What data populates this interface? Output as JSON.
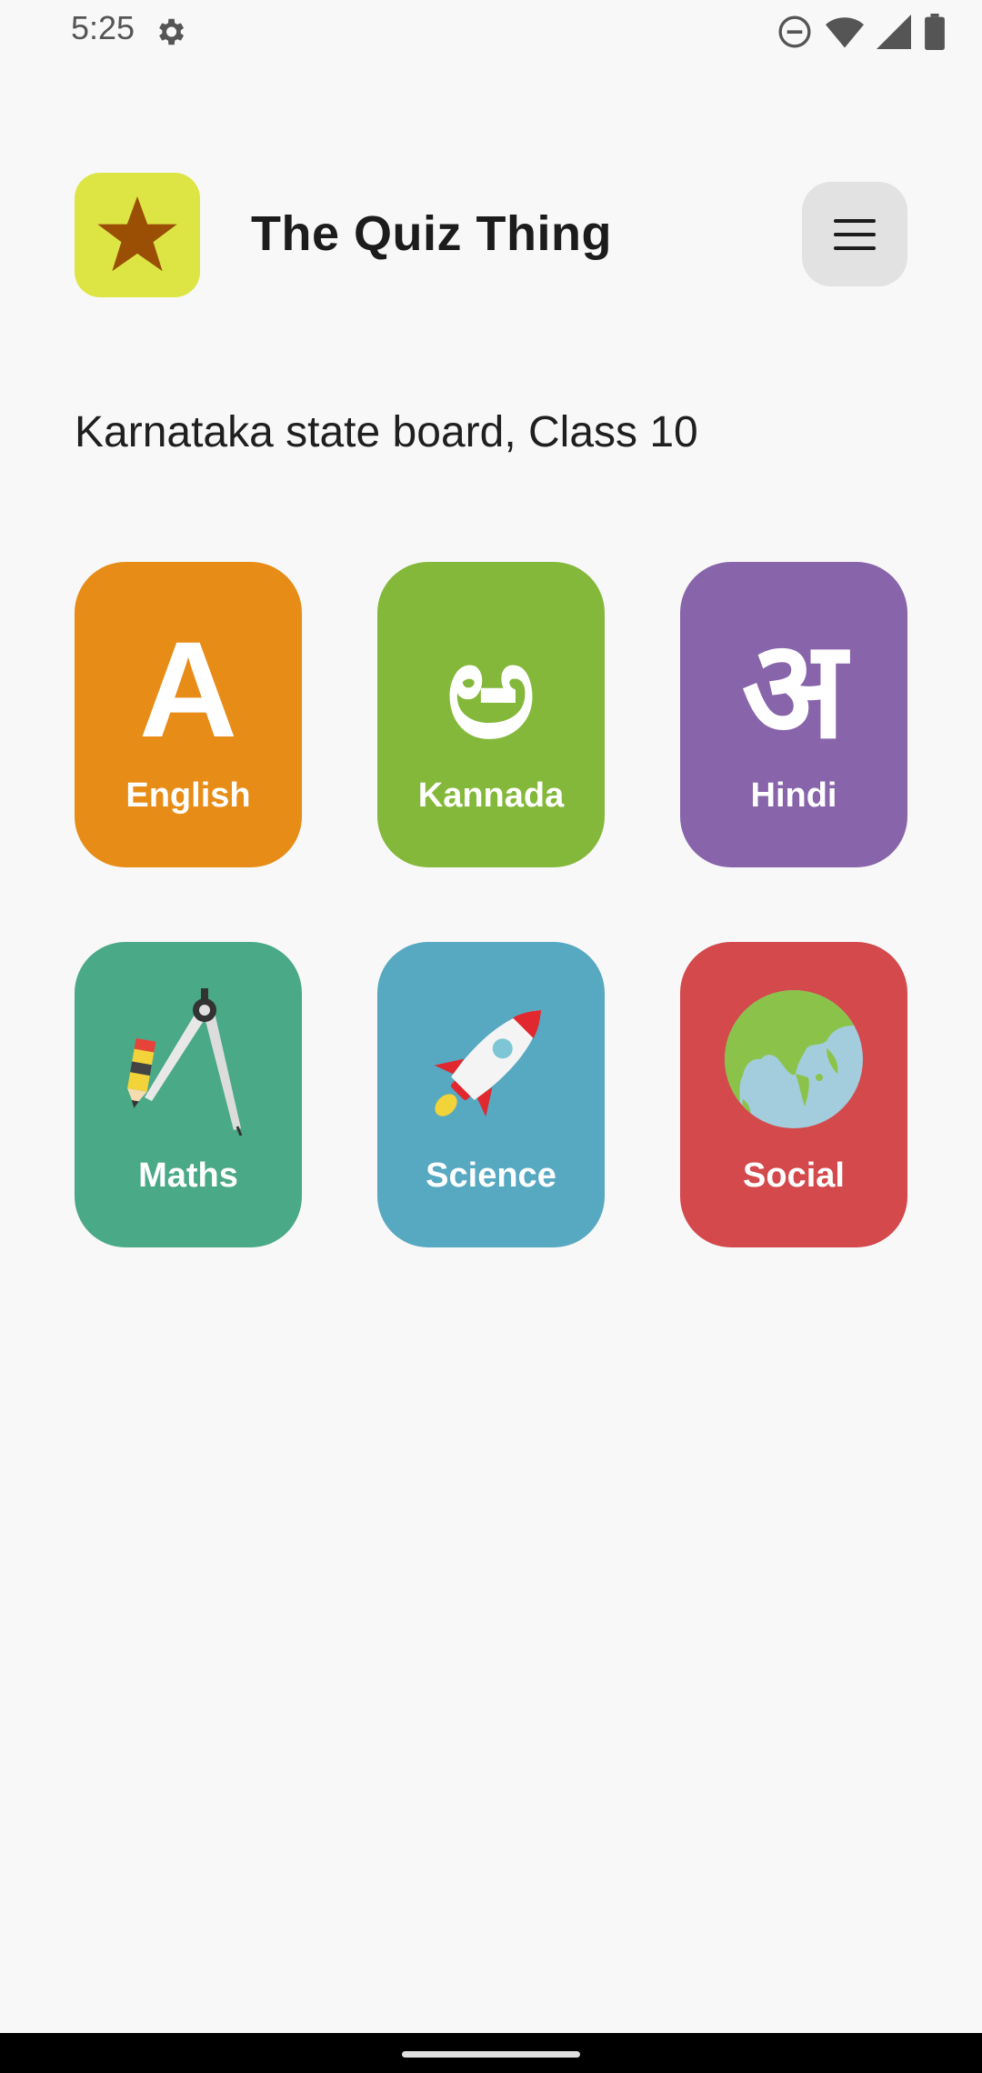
{
  "status_bar": {
    "time": "5:25",
    "icons": [
      "settings-gear-icon",
      "do-not-disturb-icon",
      "wifi-icon",
      "cellular-signal-icon",
      "battery-icon"
    ]
  },
  "header": {
    "title": "The Quiz Thing",
    "logo_icon": "star-icon",
    "logo_bg": "#dde545",
    "logo_star_color": "#9a4f05",
    "menu_icon": "hamburger-menu-icon"
  },
  "board": {
    "label": "Karnataka state board, Class 10"
  },
  "subjects": [
    {
      "label": "English",
      "glyph": "A",
      "icon": "letter-a-icon",
      "color": "#e78c17"
    },
    {
      "label": "Kannada",
      "glyph": "ಅ",
      "icon": "kannada-letter-icon",
      "color": "#84b83a"
    },
    {
      "label": "Hindi",
      "glyph": "अ",
      "icon": "hindi-letter-icon",
      "color": "#8864ab"
    },
    {
      "label": "Maths",
      "icon": "compass-pencil-icon",
      "color": "#4aa987"
    },
    {
      "label": "Science",
      "icon": "rocket-icon",
      "color": "#57a8c1"
    },
    {
      "label": "Social",
      "icon": "globe-icon",
      "color": "#d3494c"
    }
  ]
}
